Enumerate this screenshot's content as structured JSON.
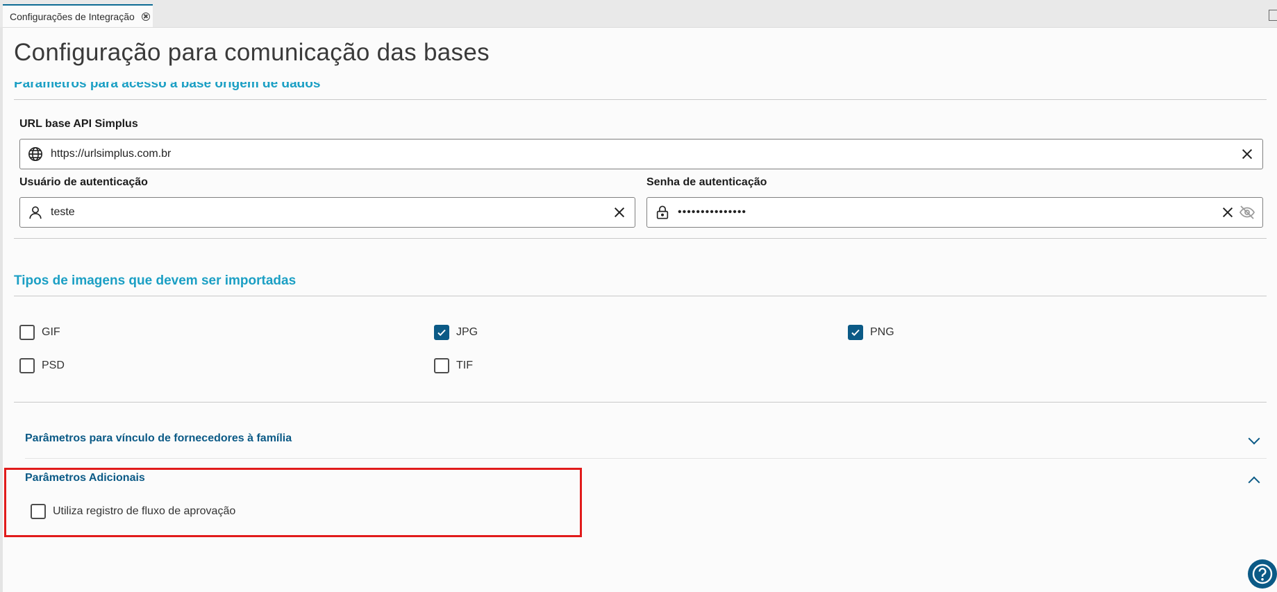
{
  "tab": {
    "label": "Configurações de Integração"
  },
  "page": {
    "title": "Configuração para comunicação das bases"
  },
  "source_section": {
    "title": "Parâmetros para acesso à base origem de dados",
    "url_label": "URL base API Simplus",
    "url_value": "https://urlsimplus.com.br",
    "user_label": "Usuário de autenticação",
    "user_value": "teste",
    "password_label": "Senha de autenticação",
    "password_value": "•••••••••••••••"
  },
  "images_section": {
    "title": "Tipos de imagens que devem ser importadas",
    "options": [
      {
        "label": "GIF",
        "checked": false
      },
      {
        "label": "JPG",
        "checked": true
      },
      {
        "label": "PNG",
        "checked": true
      },
      {
        "label": "PSD",
        "checked": false
      },
      {
        "label": "TIF",
        "checked": false
      }
    ]
  },
  "accordion": {
    "suppliers": {
      "title": "Parâmetros para vínculo de fornecedores à família",
      "expanded": false
    },
    "additional": {
      "title": "Parâmetros Adicionais",
      "expanded": true,
      "option_label": "Utiliza registro de fluxo de aprovação",
      "option_checked": false
    }
  },
  "icons": [
    "close-tab-icon",
    "globe-icon",
    "user-icon",
    "lock-icon",
    "clear-icon",
    "eye-off-icon",
    "check-icon",
    "chevron-down-icon",
    "chevron-up-icon",
    "help-icon"
  ],
  "colors": {
    "accent": "#0b5a86",
    "section_title": "#1b9fc4",
    "highlight": "#e11b1b"
  }
}
